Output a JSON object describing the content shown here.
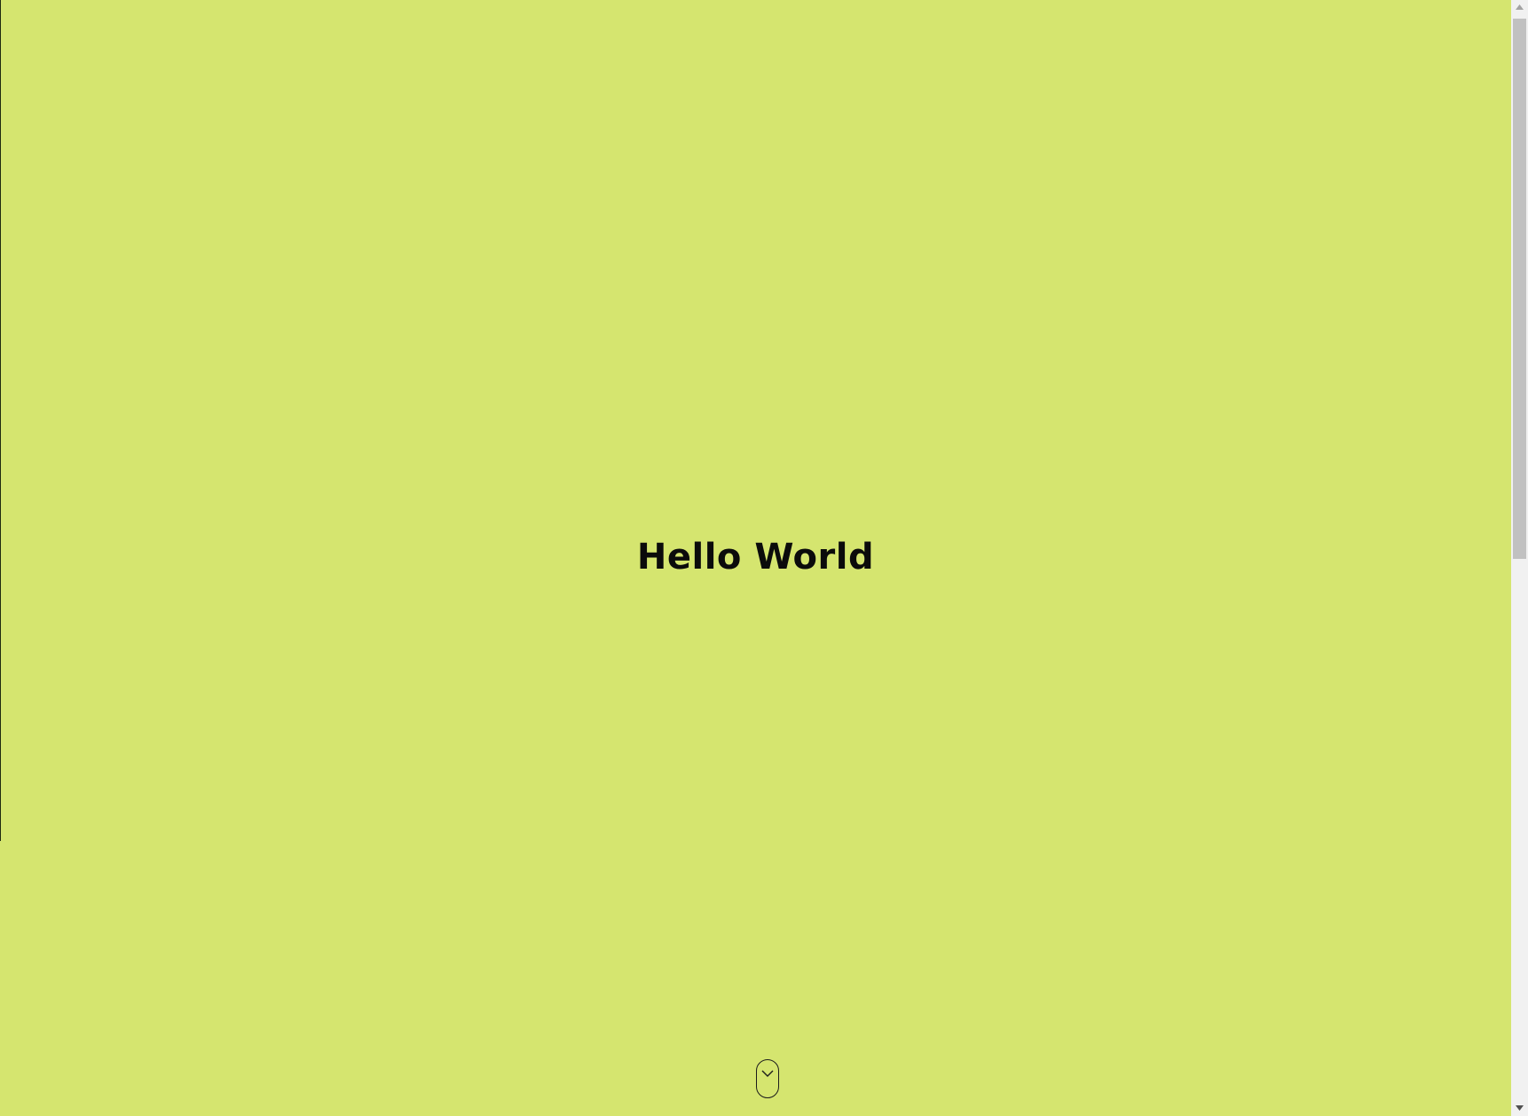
{
  "page": {
    "background_color": "#d5e56f",
    "title": "Hello World"
  },
  "scroll_hint": {
    "icon": "chevron-down-icon"
  },
  "scrollbar": {
    "up_icon": "triangle-up-icon",
    "down_icon": "triangle-down-icon",
    "scroll_position": 0
  }
}
